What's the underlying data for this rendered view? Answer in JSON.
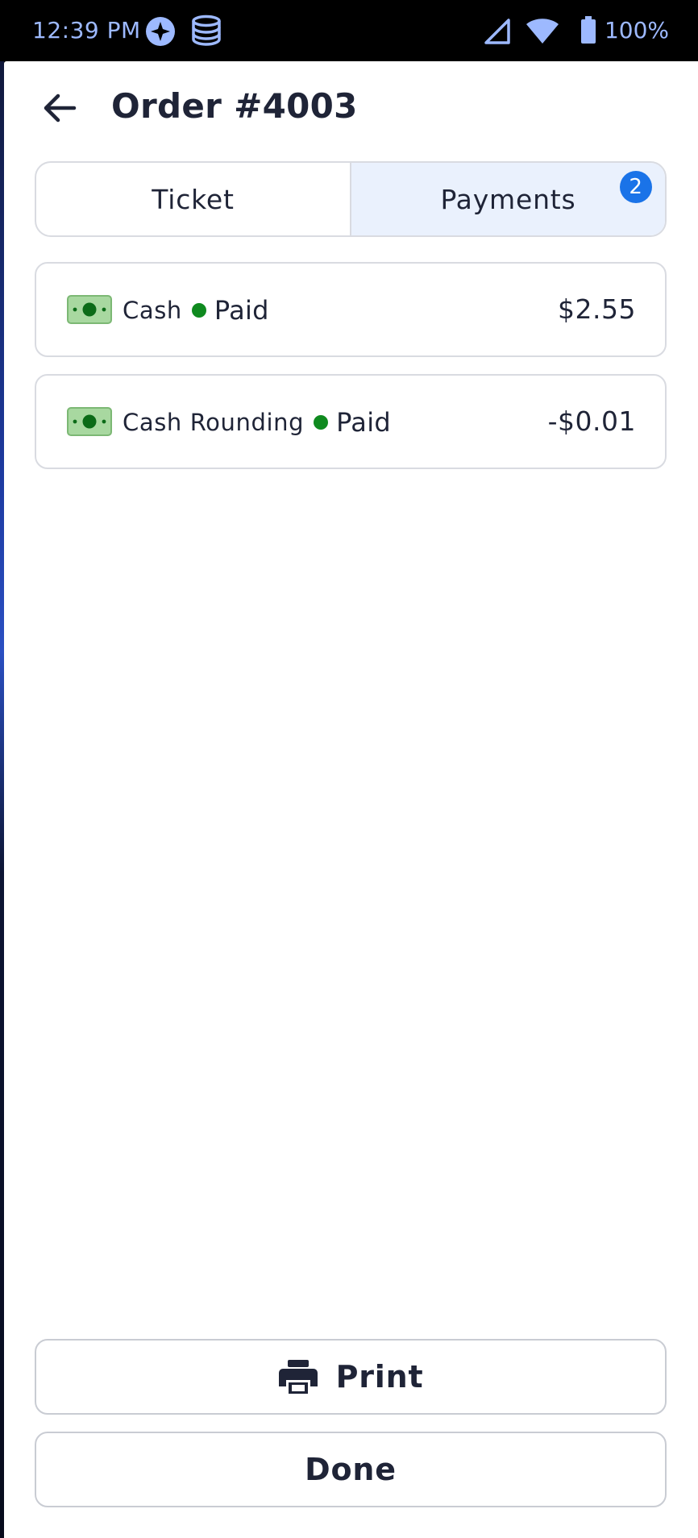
{
  "status_bar": {
    "time": "12:39 PM",
    "battery": "100%",
    "icons": [
      "compass-icon",
      "database-icon",
      "signal-icon",
      "wifi-icon",
      "battery-icon"
    ]
  },
  "header": {
    "title": "Order #4003",
    "back_icon": "arrow-left-icon"
  },
  "tabs": {
    "ticket_label": "Ticket",
    "payments_label": "Payments",
    "payments_badge": "2",
    "active": "Payments"
  },
  "payments": [
    {
      "method": "Cash",
      "status": "Paid",
      "amount": "$2.55",
      "icon": "cash-icon"
    },
    {
      "method": "Cash Rounding",
      "status": "Paid",
      "amount": "-$0.01",
      "icon": "cash-icon"
    }
  ],
  "actions": {
    "print_label": "Print",
    "done_label": "Done",
    "print_icon": "printer-icon"
  },
  "colors": {
    "status_paid": "#0f8a1f",
    "badge": "#1a73e8",
    "active_tab_bg": "#eaf1fd",
    "text": "#1f2437",
    "status_bar_text": "#9db9ff"
  }
}
